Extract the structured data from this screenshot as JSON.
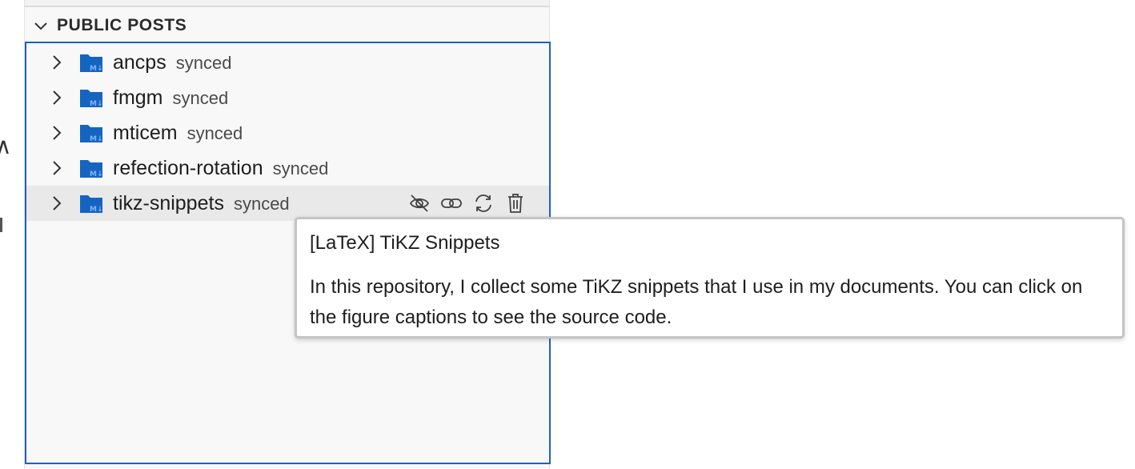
{
  "panel": {
    "section_title": "PUBLIC POSTS",
    "items": [
      {
        "name": "ancps",
        "status": "synced"
      },
      {
        "name": "fmgm",
        "status": "synced"
      },
      {
        "name": "mticem",
        "status": "synced"
      },
      {
        "name": "refection-rotation",
        "status": "synced"
      },
      {
        "name": "tikz-snippets",
        "status": "synced"
      }
    ],
    "hovered_item_actions": [
      "eye-off-icon",
      "link-icon",
      "sync-icon",
      "trash-icon"
    ]
  },
  "tooltip": {
    "title": "[LaTeX] TiKZ Snippets",
    "body": "In this repository, I collect some TiKZ snippets that I use in my documents. You can click on the figure captions to see the source code."
  },
  "colors": {
    "folder_blue": "#1565c0",
    "folder_badge": "#7fb2ff",
    "focus_border": "#1f5fc4",
    "panel_bg": "#f8f8f8",
    "hover_row_bg": "#e9e9e9"
  }
}
